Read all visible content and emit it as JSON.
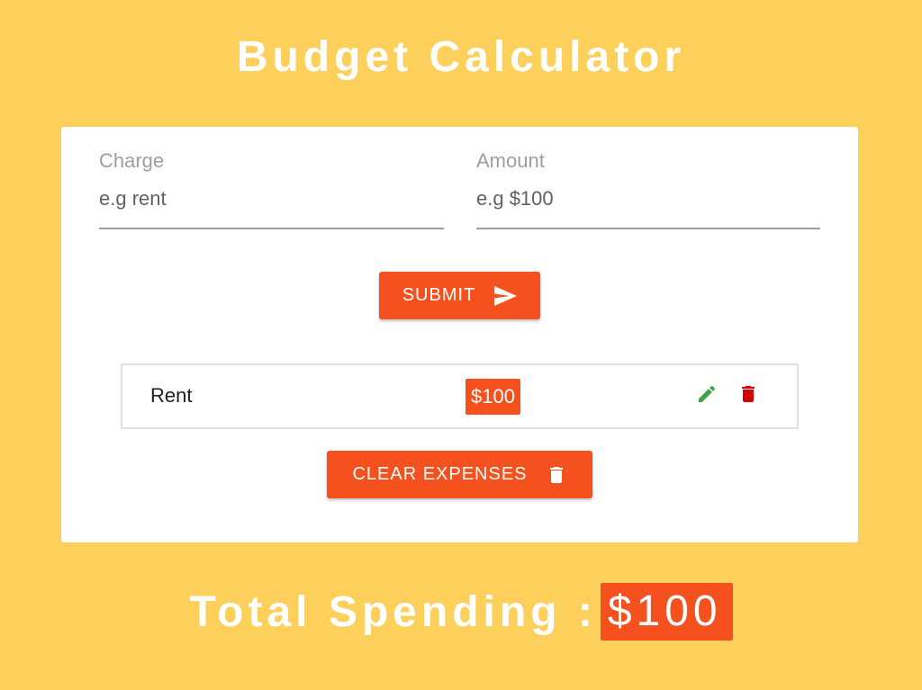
{
  "app": {
    "title": "Budget Calculator"
  },
  "form": {
    "charge": {
      "label": "Charge",
      "placeholder": "e.g rent",
      "value": ""
    },
    "amount": {
      "label": "Amount",
      "placeholder": "e.g $100",
      "value": ""
    },
    "submit_label": "SUBMIT",
    "submit_icon": "send-icon"
  },
  "expenses": [
    {
      "charge": "Rent",
      "amount": "$100",
      "edit_icon": "pencil-icon",
      "delete_icon": "trash-icon"
    }
  ],
  "clear_button": {
    "label": "CLEAR EXPENSES",
    "icon": "trash-icon"
  },
  "total": {
    "label": "Total Spending :",
    "amount": "$100"
  },
  "colors": {
    "background": "#fcd05a",
    "accent": "#f4511e",
    "edit": "#43a047",
    "delete": "#d50000"
  }
}
